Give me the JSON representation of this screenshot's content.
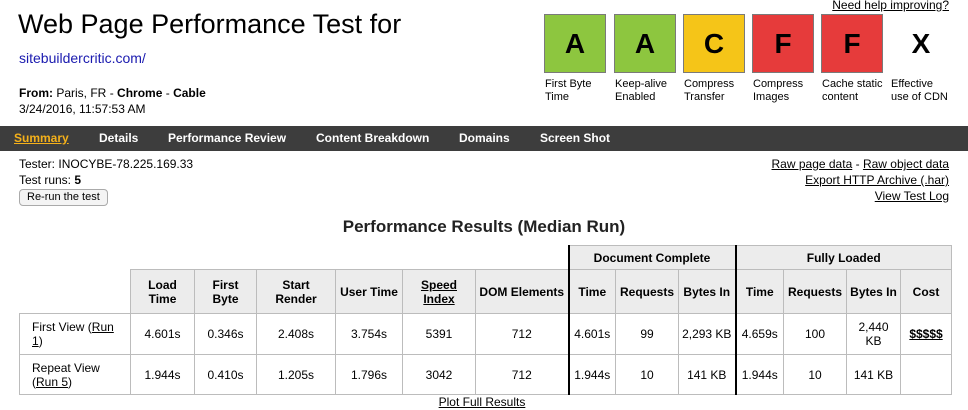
{
  "header": {
    "title": "Web Page Performance Test for",
    "site_url": "sitebuildercritic.com/",
    "from_prefix": "From:",
    "location": "Paris, FR",
    "sep": "-",
    "browser": "Chrome",
    "connection": "Cable",
    "date": "3/24/2016, 11:57:53 AM",
    "help_link": "Need help improving?"
  },
  "grades": [
    {
      "letter": "A",
      "label": "First Byte Time",
      "color": "#8dc63f"
    },
    {
      "letter": "A",
      "label": "Keep-alive Enabled",
      "color": "#8dc63f"
    },
    {
      "letter": "C",
      "label": "Compress Transfer",
      "color": "#f5c518"
    },
    {
      "letter": "F",
      "label": "Compress Images",
      "color": "#e63b3b"
    },
    {
      "letter": "F",
      "label": "Cache static content",
      "color": "#e63b3b"
    },
    {
      "letter": "X",
      "label": "Effective use of CDN",
      "color": "#ffffff"
    }
  ],
  "nav": {
    "items": [
      "Summary",
      "Details",
      "Performance Review",
      "Content Breakdown",
      "Domains",
      "Screen Shot"
    ],
    "active_color": "#f5b11a",
    "bg_color": "#3d3d3d"
  },
  "test_info": {
    "tester_label": "Tester:",
    "tester": "INOCYBE-78.225.169.33",
    "runs_label": "Test runs:",
    "runs": "5",
    "rerun_button": "Re-run the test"
  },
  "raw_links": {
    "raw_page": "Raw page data",
    "dash": "-",
    "raw_object": "Raw object data",
    "export_har": "Export HTTP Archive (.har)",
    "view_log": "View Test Log"
  },
  "results": {
    "heading": "Performance Results (Median Run)",
    "group_document": "Document Complete",
    "group_fully": "Fully Loaded",
    "columns": {
      "load_time": "Load Time",
      "first_byte": "First Byte",
      "start_render": "Start Render",
      "user_time": "User Time",
      "speed_index": "Speed Index",
      "dom_elements": "DOM Elements",
      "doc_time": "Time",
      "doc_requests": "Requests",
      "doc_bytes": "Bytes In",
      "fl_time": "Time",
      "fl_requests": "Requests",
      "fl_bytes": "Bytes In",
      "cost": "Cost"
    },
    "rows": [
      {
        "label": "First View (",
        "run_link": "Run 1",
        "label_end": ")",
        "load_time": "4.601s",
        "first_byte": "0.346s",
        "start_render": "2.408s",
        "user_time": "3.754s",
        "speed_index": "5391",
        "dom_elements": "712",
        "doc_time": "4.601s",
        "doc_requests": "99",
        "doc_bytes": "2,293 KB",
        "fl_time": "4.659s",
        "fl_requests": "100",
        "fl_bytes": "2,440 KB",
        "cost": "$$$$$"
      },
      {
        "label": "Repeat View (",
        "run_link": "Run 5",
        "label_end": ")",
        "load_time": "1.944s",
        "first_byte": "0.410s",
        "start_render": "1.205s",
        "user_time": "1.796s",
        "speed_index": "3042",
        "dom_elements": "712",
        "doc_time": "1.944s",
        "doc_requests": "10",
        "doc_bytes": "141 KB",
        "fl_time": "1.944s",
        "fl_requests": "10",
        "fl_bytes": "141 KB",
        "cost": ""
      }
    ],
    "plot_link": "Plot Full Results"
  }
}
